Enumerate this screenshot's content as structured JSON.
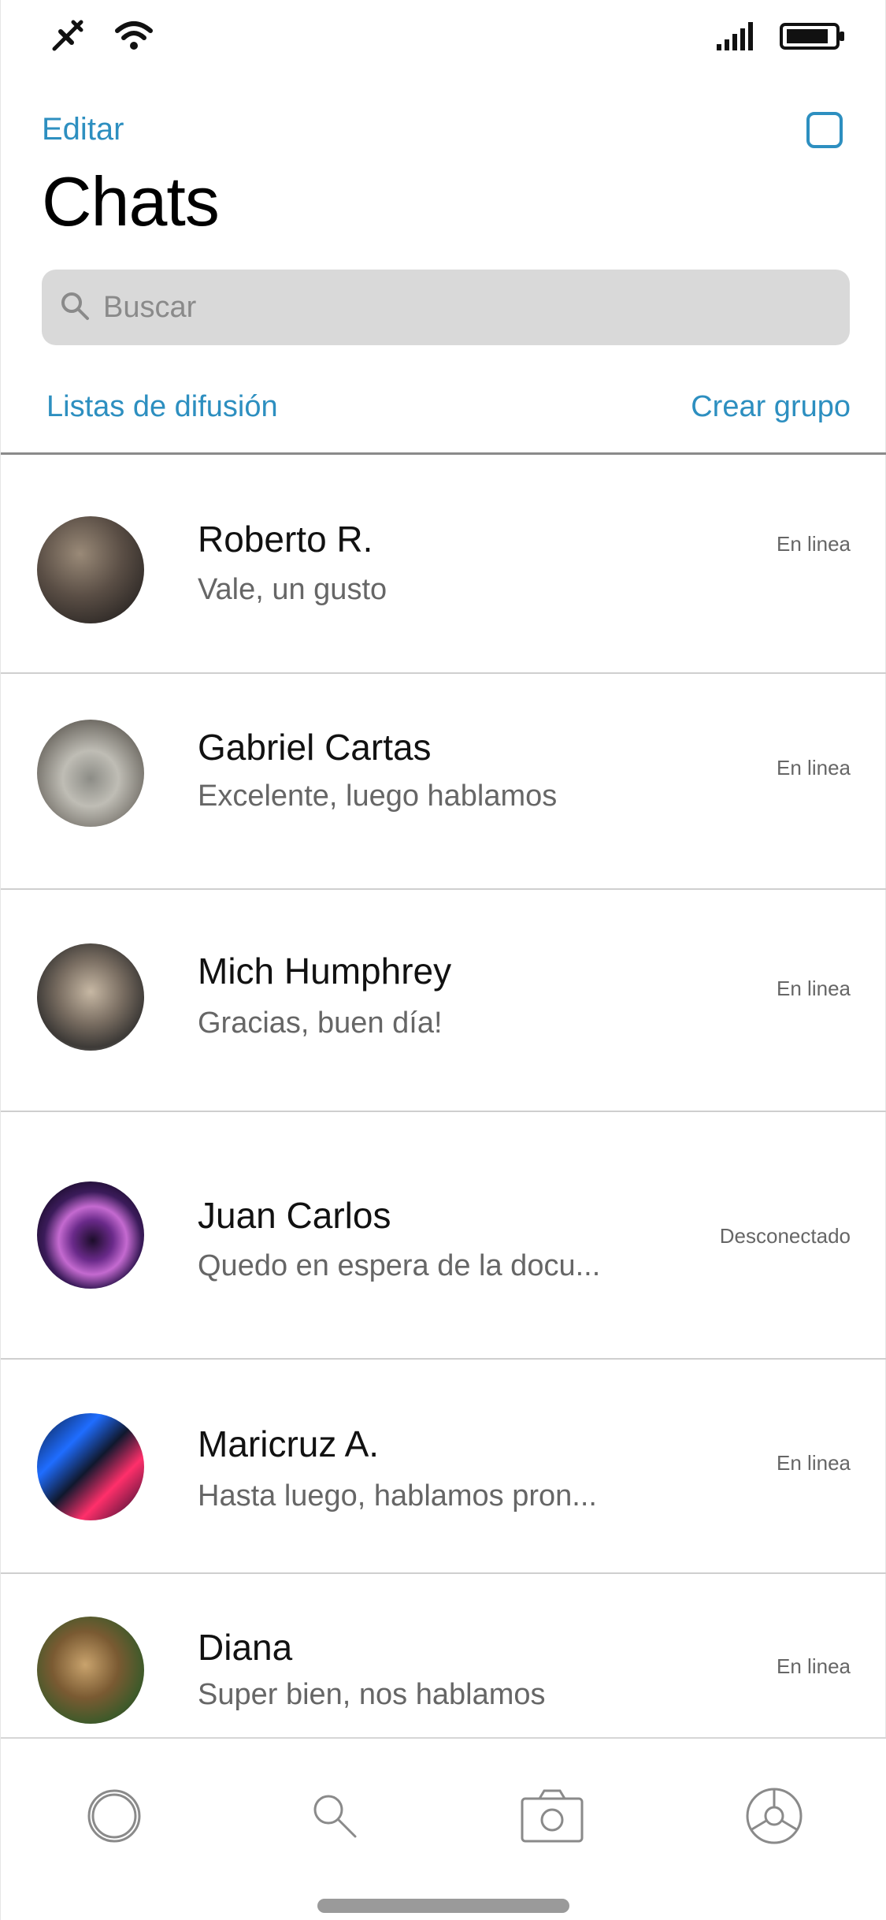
{
  "header": {
    "edit_label": "Editar",
    "title": "Chats",
    "search_placeholder": "Buscar",
    "broadcast_label": "Listas de difusión",
    "new_group_label": "Crear grupo"
  },
  "chats": [
    {
      "name": "Roberto R.",
      "preview": "Vale, un gusto",
      "status": "En linea"
    },
    {
      "name": "Gabriel Cartas",
      "preview": "Excelente, luego hablamos",
      "status": "En linea"
    },
    {
      "name": "Mich Humphrey",
      "preview": "Gracias, buen día!",
      "status": "En linea"
    },
    {
      "name": "Juan Carlos",
      "preview": "Quedo en espera de la docu...",
      "status": "Desconectado"
    },
    {
      "name": "Maricruz A.",
      "preview": "Hasta luego, hablamos pron...",
      "status": "En linea"
    },
    {
      "name": "Diana",
      "preview": "Super bien, nos hablamos",
      "status": "En linea"
    }
  ],
  "colors": {
    "accent": "#2d8fc0",
    "search_bg": "#d9d9d9",
    "divider": "#cfcfcf"
  },
  "icons": {
    "status_left": [
      "airplane-mode-icon",
      "wifi-icon"
    ],
    "status_right": [
      "cellular-signal-icon",
      "battery-icon"
    ],
    "header": "compose-icon",
    "tabs": [
      "status-icon",
      "search-icon",
      "camera-icon",
      "settings-icon"
    ]
  }
}
